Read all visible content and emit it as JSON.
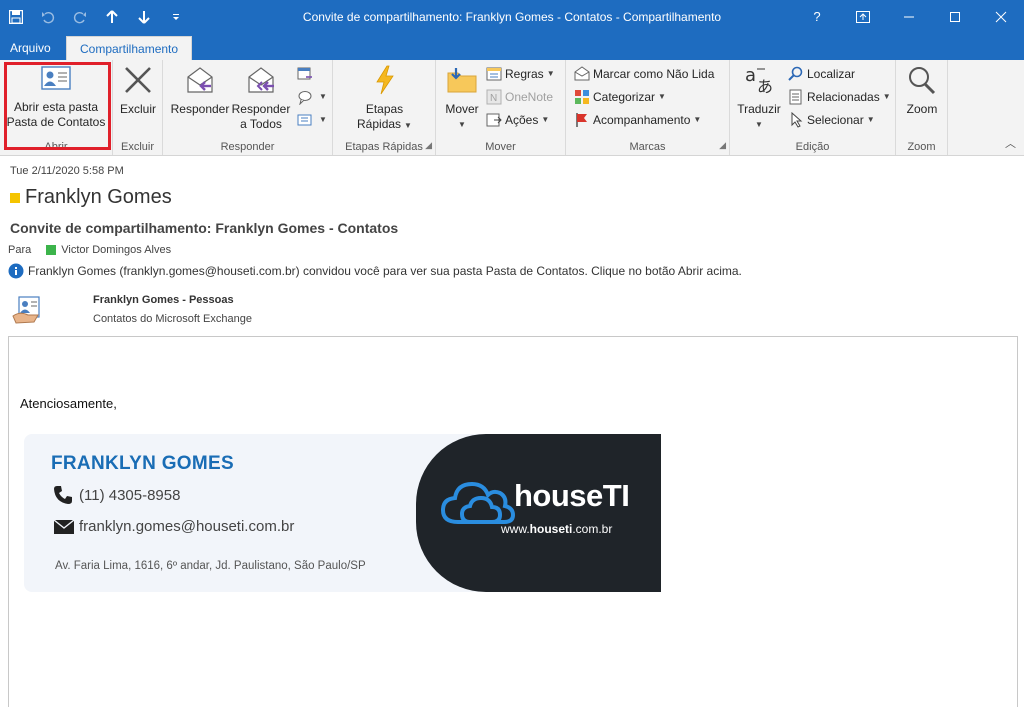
{
  "window": {
    "title": "Convite de compartilhamento: Franklyn Gomes - Contatos  -  Compartilhamento",
    "help": "?"
  },
  "tabs": {
    "file": "Arquivo",
    "active": "Compartilhamento"
  },
  "ribbon": {
    "abrir": {
      "button_line1": "Abrir esta pasta",
      "button_line2": "Pasta de Contatos",
      "label": "Abrir"
    },
    "excluir": {
      "button": "Excluir",
      "label": "Excluir"
    },
    "responder": {
      "reply": "Responder",
      "reply_all_line1": "Responder",
      "reply_all_line2": "a Todos",
      "label": "Responder"
    },
    "etapas": {
      "line1": "Etapas",
      "line2": "Rápidas",
      "label": "Etapas Rápidas"
    },
    "mover": {
      "move": "Mover",
      "rules": "Regras",
      "onenote": "OneNote",
      "actions": "Ações",
      "label": "Mover"
    },
    "marcas": {
      "unread": "Marcar como Não Lida",
      "categorize": "Categorizar",
      "followup": "Acompanhamento",
      "label": "Marcas"
    },
    "edicao": {
      "translate": "Traduzir",
      "find": "Localizar",
      "related": "Relacionadas",
      "select": "Selecionar",
      "label": "Edição"
    },
    "zoom": {
      "button": "Zoom",
      "label": "Zoom"
    }
  },
  "message": {
    "date": "Tue 2/11/2020 5:58 PM",
    "sender": "Franklyn Gomes",
    "subject": "Convite de compartilhamento: Franklyn Gomes - Contatos",
    "to_label": "Para",
    "to_name": "Victor Domingos Alves",
    "info": "Franklyn Gomes (franklyn.gomes@houseti.com.br) convidou você para ver sua pasta Pasta de Contatos.  Clique no botão Abrir acima.",
    "attachment_title": "Franklyn Gomes - Pessoas",
    "attachment_subtitle": "Contatos do Microsoft Exchange"
  },
  "body": {
    "closing": "Atenciosamente,",
    "signature": {
      "name": "FRANKLYN GOMES",
      "phone": "(11) 4305-8958",
      "email": "franklyn.gomes@houseti.com.br",
      "address": "Av. Faria Lima, 1616, 6º andar, Jd. Paulistano, São Paulo/SP",
      "brand": "houseTI",
      "url_prefix": "www.",
      "url_bold": "houseti",
      "url_suffix": ".com.br"
    }
  },
  "colors": {
    "titlebar": "#1e6cc0",
    "highlight": "#e0202a",
    "brand_blue": "#1a6db5"
  }
}
